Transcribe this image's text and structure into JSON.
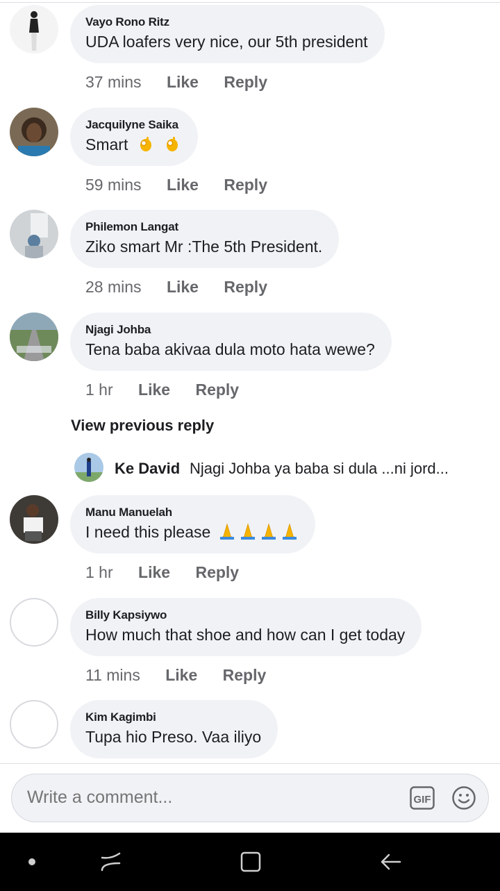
{
  "comments": [
    {
      "author": "Vayo Rono Ritz",
      "text": "UDA loafers very nice, our 5th president",
      "time": "37 mins",
      "like": "Like",
      "reply": "Reply"
    },
    {
      "author": "Jacquilyne Saika",
      "text": "Smart",
      "time": "59 mins",
      "like": "Like",
      "reply": "Reply",
      "emoji": "ok-hand-emoji"
    },
    {
      "author": "Philemon Langat",
      "text": "Ziko smart Mr :The 5th President.",
      "time": "28 mins",
      "like": "Like",
      "reply": "Reply"
    },
    {
      "author": "Njagi Johba",
      "text": "Tena baba akivaa dula moto hata wewe?",
      "time": "1 hr",
      "like": "Like",
      "reply": "Reply"
    },
    {
      "author": "Manu Manuelah",
      "text": "I need this please",
      "time": "1 hr",
      "like": "Like",
      "reply": "Reply",
      "emoji": "folded-hands-emoji"
    },
    {
      "author": "Billy Kapsiywo",
      "text": "How much that shoe and how can I get today",
      "time": "11 mins",
      "like": "Like",
      "reply": "Reply"
    },
    {
      "author": "Kim Kagimbi",
      "text": "Tupa hio Preso. Vaa iliyo"
    }
  ],
  "thread": {
    "view_previous": "View previous reply",
    "reply_author": "Ke David",
    "reply_text": "Njagi Johba ya baba si dula ...ni jord..."
  },
  "composer": {
    "placeholder": "Write a comment...",
    "gif_label": "GIF"
  },
  "colors": {
    "bubble": "#f0f2f5",
    "meta": "#65676b",
    "text": "#1c1e21",
    "navbar": "#000000"
  },
  "icons": [
    "gif-icon",
    "emoji-icon",
    "nav-dot-icon",
    "recent-apps-icon",
    "home-icon",
    "back-icon"
  ]
}
